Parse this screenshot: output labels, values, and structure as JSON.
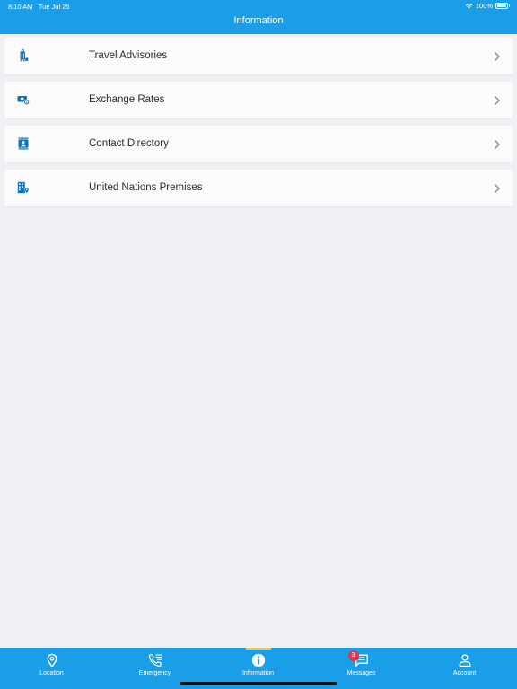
{
  "status_bar": {
    "time": "8:10 AM",
    "date": "Tue Jul 25",
    "battery": "100%",
    "battery_level": 1.0,
    "wifi_icon": "wifi-icon"
  },
  "header": {
    "title": "Information"
  },
  "menu": {
    "items": [
      {
        "label": "Travel Advisories",
        "icon": "luggage-icon"
      },
      {
        "label": "Exchange Rates",
        "icon": "currency-exchange-icon"
      },
      {
        "label": "Contact Directory",
        "icon": "contact-card-icon"
      },
      {
        "label": "United Nations Premises",
        "icon": "building-location-icon"
      }
    ]
  },
  "tabs": [
    {
      "label": "Location",
      "icon": "location-pin-icon"
    },
    {
      "label": "Emergency",
      "icon": "phone-list-icon"
    },
    {
      "label": "Information",
      "icon": "info-icon",
      "active": true
    },
    {
      "label": "Messages",
      "icon": "message-icon",
      "badge": "3"
    },
    {
      "label": "Account",
      "icon": "person-icon"
    }
  ],
  "colors": {
    "primary": "#1a9ee8",
    "icon_blue": "#0b74c2",
    "active_indicator": "#f4c34d",
    "badge": "#e0364f",
    "background": "#efeff4",
    "row_background": "#fbfbfb"
  }
}
